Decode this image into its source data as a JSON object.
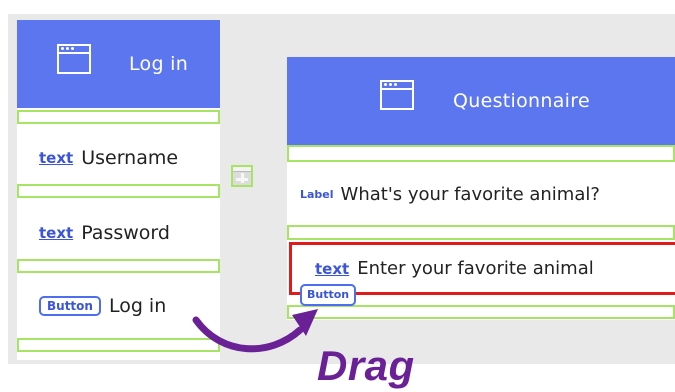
{
  "login_screen": {
    "title": "Log in",
    "icon": "window-icon",
    "rows": [
      {
        "tag": "text",
        "label": "Username"
      },
      {
        "tag": "text",
        "label": "Password"
      },
      {
        "tag": "Button",
        "label": "Log in"
      }
    ]
  },
  "add_icon": "plus-icon",
  "questionnaire_screen": {
    "title": "Questionnaire",
    "icon": "window-icon",
    "label_row": {
      "tag": "Label",
      "text": "What's your favorite animal?"
    },
    "text_row": {
      "tag": "text",
      "text": "Enter your favorite animal"
    },
    "dragged_button": {
      "tag": "Button"
    }
  },
  "annotation": {
    "drag_text": "Drag"
  },
  "colors": {
    "title_bar": "#5b76ef",
    "spacer_border": "#a7e463",
    "selection_border": "#e01b1b",
    "drag_annotation": "#6a2196",
    "tag_blue": "#3a55d8"
  }
}
